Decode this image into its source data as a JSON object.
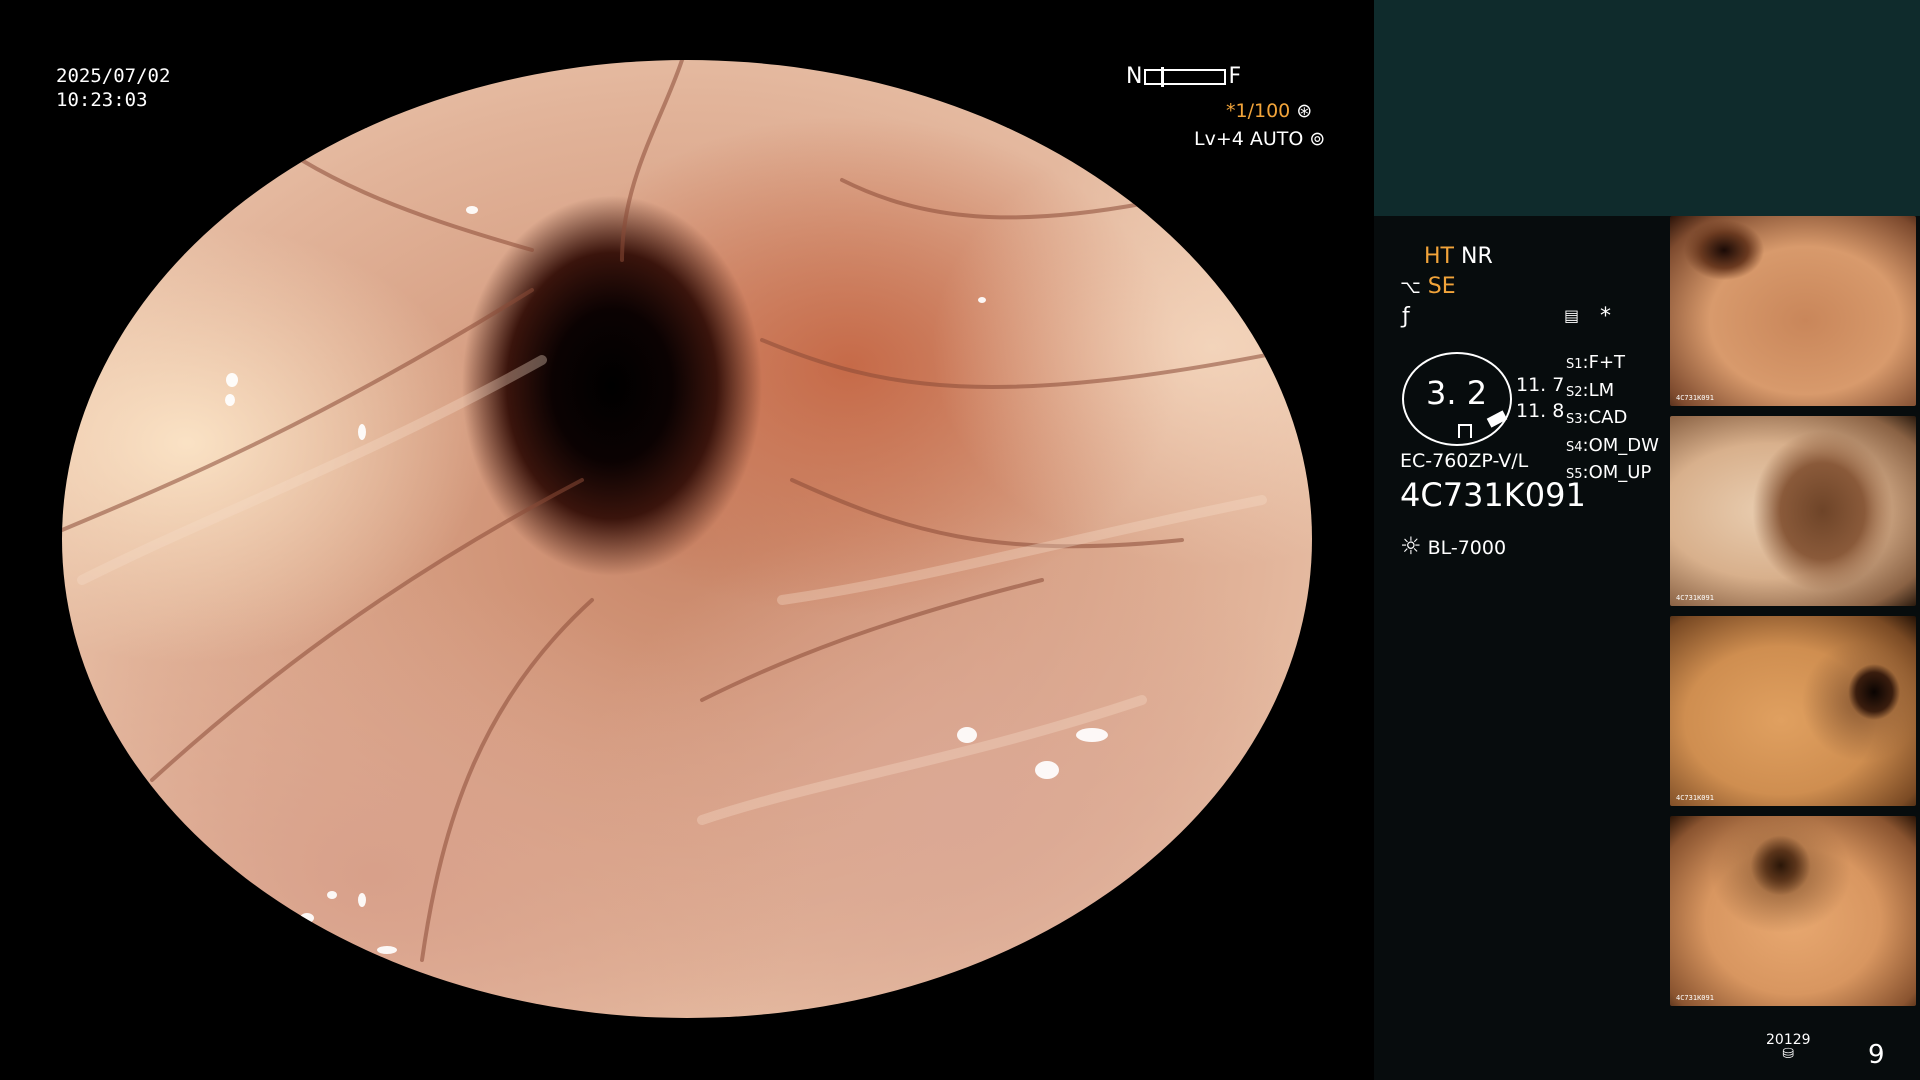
{
  "datetime": {
    "date": "2025/07/02",
    "time": "10:23:03"
  },
  "focus_scale": {
    "near": "N",
    "far": "F",
    "position_fraction": 0.18
  },
  "shutter": {
    "value": "*1/100",
    "icon": "aperture-icon"
  },
  "level": {
    "value": "Lv+4 AUTO",
    "icon": "iris-icon"
  },
  "modes": {
    "ht": "HT",
    "nr": "NR",
    "se": "SE"
  },
  "scope_info": {
    "score": "3. 2",
    "reading_1": "11. 7",
    "reading_2": "11. 8",
    "model": "EC-760ZP-V/L",
    "serial": "4C731K091",
    "light_source": "BL-7000",
    "asterisk": "*"
  },
  "presets": [
    {
      "key": "S1",
      "value": "F+T"
    },
    {
      "key": "S2",
      "value": "LM"
    },
    {
      "key": "S3",
      "value": "CAD"
    },
    {
      "key": "S4",
      "value": "OM_DW"
    },
    {
      "key": "S5",
      "value": "OM_UP"
    }
  ],
  "thumbnails": [
    {
      "label": "4C731K091"
    },
    {
      "label": "4C731K091"
    },
    {
      "label": "4C731K091"
    },
    {
      "label": "4C731K091"
    }
  ],
  "footer": {
    "counter": "20129",
    "page": "9"
  },
  "colors": {
    "accent": "#f2a43a",
    "panel": "#0f2b2c"
  }
}
